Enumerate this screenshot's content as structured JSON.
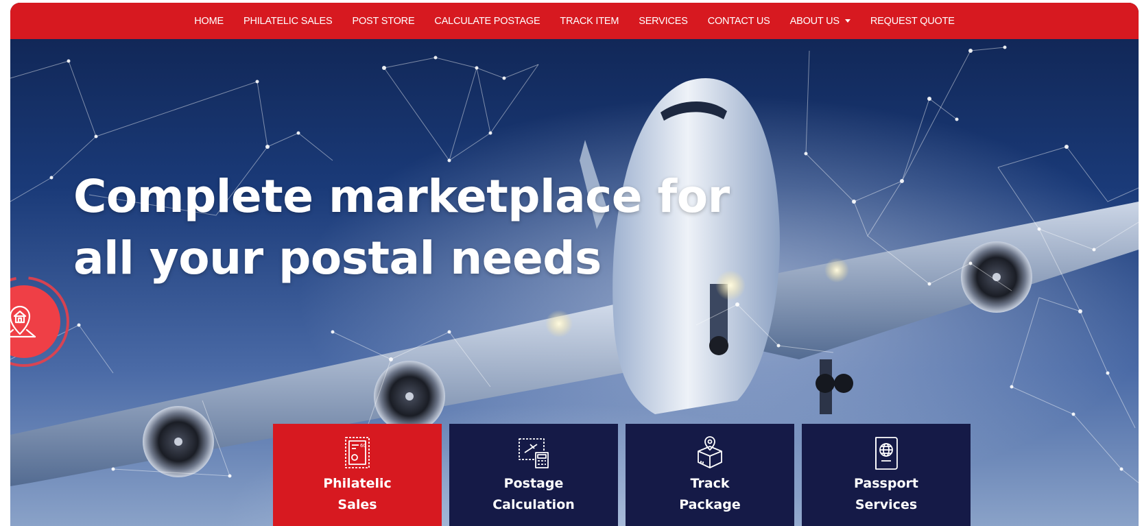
{
  "nav": {
    "items": [
      {
        "label": "HOME"
      },
      {
        "label": "PHILATELIC SALES"
      },
      {
        "label": "POST STORE"
      },
      {
        "label": "CALCULATE POSTAGE"
      },
      {
        "label": "TRACK ITEM"
      },
      {
        "label": "SERVICES"
      },
      {
        "label": "CONTACT US"
      },
      {
        "label": "ABOUT US",
        "has_dropdown": true
      },
      {
        "label": "REQUEST QUOTE"
      }
    ]
  },
  "hero": {
    "headline_line1": "Complete marketplace for",
    "headline_line2": "all your postal needs"
  },
  "floating_badge": {
    "icon": "home-location-icon"
  },
  "cards": [
    {
      "line1": "Philatelic",
      "line2": "Sales",
      "icon": "stamp-icon",
      "active": true
    },
    {
      "line1": "Postage",
      "line2": "Calculation",
      "icon": "postage-calculator-icon",
      "active": false
    },
    {
      "line1": "Track",
      "line2": "Package",
      "icon": "package-location-icon",
      "active": false
    },
    {
      "line1": "Passport",
      "line2": "Services",
      "icon": "passport-icon",
      "active": false
    }
  ],
  "colors": {
    "brand_red": "#d71920",
    "card_navy": "#151a47",
    "text_white": "#ffffff"
  }
}
